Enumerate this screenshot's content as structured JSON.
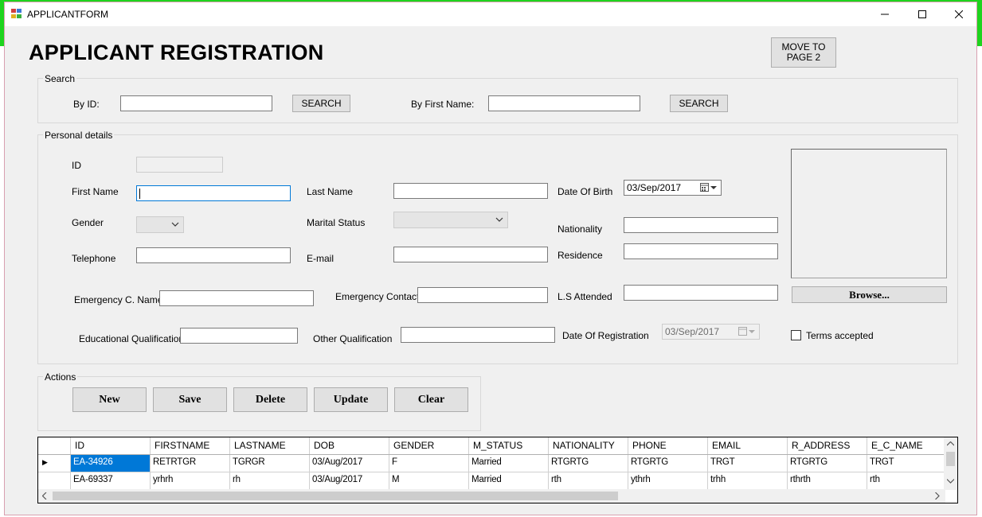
{
  "window": {
    "title": "APPLICANTFORM",
    "minimize_glyph": "—",
    "maximize_glyph": "☐",
    "close_glyph": "✕"
  },
  "header": {
    "title": "APPLICANT REGISTRATION",
    "move_button": "MOVE TO PAGE 2"
  },
  "search": {
    "group_title": "Search",
    "by_id_label": "By ID:",
    "by_id_value": "",
    "search_button_1": "SEARCH",
    "by_first_name_label": "By First Name:",
    "by_first_name_value": "",
    "search_button_2": "SEARCH"
  },
  "personal": {
    "group_title": "Personal details",
    "id_label": "ID",
    "id_value": "",
    "first_name_label": "First Name",
    "first_name_value": "",
    "last_name_label": "Last Name",
    "last_name_value": "",
    "dob_label": "Date Of Birth",
    "dob_value": "03/Sep/2017",
    "gender_label": "Gender",
    "gender_value": "",
    "marital_status_label": "Marital Status",
    "marital_status_value": "",
    "nationality_label": "Nationality",
    "nationality_value": "",
    "telephone_label": "Telephone",
    "telephone_value": "",
    "email_label": "E-mail",
    "email_value": "",
    "residence_label": "Residence",
    "residence_value": "",
    "emergency_name_label": "Emergency C. Name",
    "emergency_name_value": "",
    "emergency_contact_label": "Emergency Contact",
    "emergency_contact_value": "",
    "ls_attended_label": "L.S Attended",
    "ls_attended_value": "",
    "browse_button": "Browse...",
    "edu_qual_label": "Educational Qualification",
    "edu_qual_value": "",
    "other_qual_label": "Other Qualification",
    "other_qual_value": "",
    "dor_label": "Date Of Registration",
    "dor_value": "03/Sep/2017",
    "terms_label": "Terms accepted",
    "terms_checked": false
  },
  "actions": {
    "group_title": "Actions",
    "new": "New",
    "save": "Save",
    "delete": "Delete",
    "update": "Update",
    "clear": "Clear"
  },
  "grid": {
    "columns": [
      "ID",
      "FIRSTNAME",
      "LASTNAME",
      "DOB",
      "GENDER",
      "M_STATUS",
      "NATIONALITY",
      "PHONE",
      "EMAIL",
      "R_ADDRESS",
      "E_C_NAME"
    ],
    "rows": [
      [
        "EA-34926",
        "RETRTGR",
        "TGRGR",
        "03/Aug/2017",
        "F",
        "Married",
        "RTGRTG",
        "RTGRTG",
        "TRGT",
        "RTGRTG",
        "TRGT"
      ],
      [
        "EA-69337",
        "yrhrh",
        "rh",
        "03/Aug/2017",
        "M",
        "Married",
        "rth",
        "ythrh",
        "trhh",
        "rthrth",
        "rth"
      ]
    ],
    "current_row_marker": "▶",
    "scroll_left": "<",
    "scroll_right": ">",
    "scroll_up": "^",
    "scroll_down": "v"
  },
  "colors": {
    "accent": "#0078d7",
    "outer_background": "#1ed41e",
    "form_background": "#f0f0f0"
  }
}
